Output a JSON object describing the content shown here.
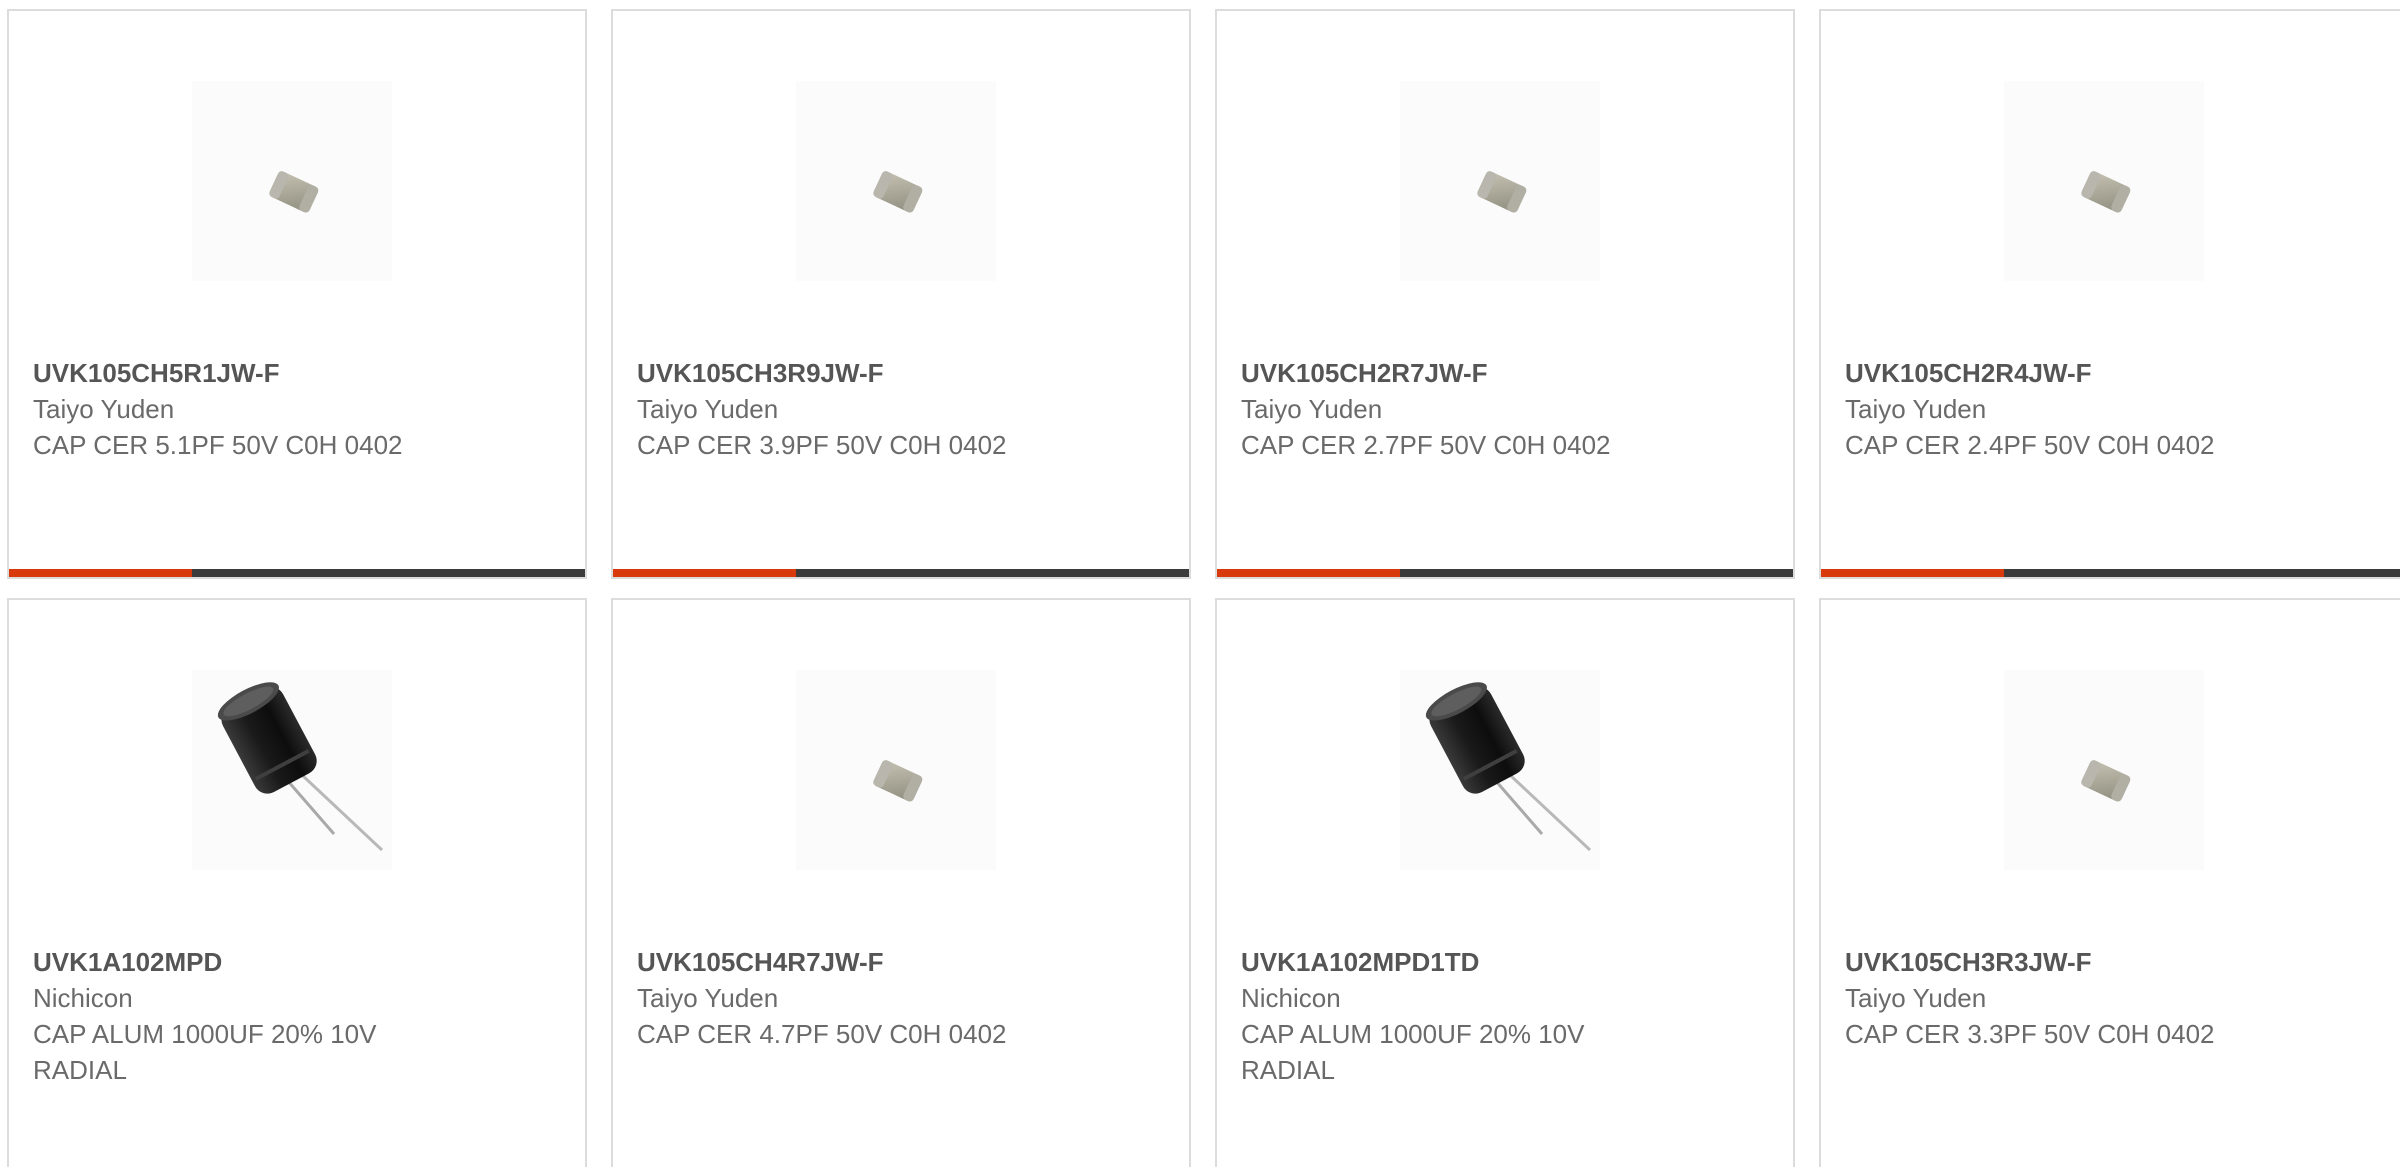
{
  "colors": {
    "accent": "#d83a0c",
    "bar": "#3b3b3b",
    "border": "#dcdcdc",
    "text": "#6a6a6a"
  },
  "products": [
    {
      "part_number": "UVK105CH5R1JW-F",
      "manufacturer": "Taiyo Yuden",
      "description": "CAP CER 5.1PF 50V C0H 0402",
      "image": "ceramic-chip-capacitor"
    },
    {
      "part_number": "UVK105CH3R9JW-F",
      "manufacturer": "Taiyo Yuden",
      "description": "CAP CER 3.9PF 50V C0H 0402",
      "image": "ceramic-chip-capacitor"
    },
    {
      "part_number": "UVK105CH2R7JW-F",
      "manufacturer": "Taiyo Yuden",
      "description": "CAP CER 2.7PF 50V C0H 0402",
      "image": "ceramic-chip-capacitor"
    },
    {
      "part_number": "UVK105CH2R4JW-F",
      "manufacturer": "Taiyo Yuden",
      "description": "CAP CER 2.4PF 50V C0H 0402",
      "image": "ceramic-chip-capacitor"
    },
    {
      "part_number": "UVK1A102MPD",
      "manufacturer": "Nichicon",
      "description": "CAP ALUM 1000UF 20% 10V RADIAL",
      "image": "electrolytic-capacitor"
    },
    {
      "part_number": "UVK105CH4R7JW-F",
      "manufacturer": "Taiyo Yuden",
      "description": "CAP CER 4.7PF 50V C0H 0402",
      "image": "ceramic-chip-capacitor"
    },
    {
      "part_number": "UVK1A102MPD1TD",
      "manufacturer": "Nichicon",
      "description": "CAP ALUM 1000UF 20% 10V RADIAL",
      "image": "electrolytic-capacitor"
    },
    {
      "part_number": "UVK105CH3R3JW-F",
      "manufacturer": "Taiyo Yuden",
      "description": "CAP CER 3.3PF 50V C0H 0402",
      "image": "ceramic-chip-capacitor"
    }
  ]
}
